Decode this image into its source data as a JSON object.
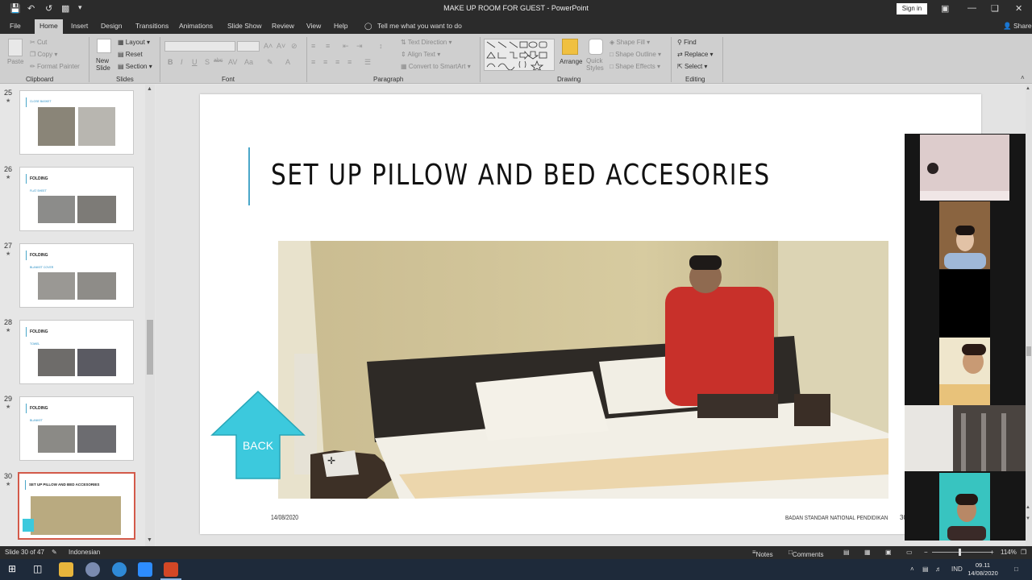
{
  "window": {
    "title": "MAKE UP ROOM FOR GUEST  -  PowerPoint",
    "sign_in": "Sign in"
  },
  "tabs": [
    "File",
    "Home",
    "Insert",
    "Design",
    "Transitions",
    "Animations",
    "Slide Show",
    "Review",
    "View",
    "Help"
  ],
  "tell_me": "Tell me what you want to do",
  "share": "Share",
  "ribbon": {
    "clipboard": {
      "label": "Clipboard",
      "paste": "Paste",
      "cut": "Cut",
      "copy": "Copy",
      "format_painter": "Format Painter"
    },
    "slides": {
      "label": "Slides",
      "new_slide": "New Slide",
      "layout": "Layout",
      "reset": "Reset",
      "section": "Section"
    },
    "font": {
      "label": "Font"
    },
    "paragraph": {
      "label": "Paragraph",
      "text_direction": "Text Direction",
      "align_text": "Align Text",
      "convert_smartart": "Convert to SmartArt"
    },
    "drawing": {
      "label": "Drawing",
      "arrange": "Arrange",
      "quick_styles": "Quick Styles",
      "shape_fill": "Shape Fill",
      "shape_outline": "Shape Outline",
      "shape_effects": "Shape Effects"
    },
    "editing": {
      "label": "Editing",
      "find": "Find",
      "replace": "Replace",
      "select": "Select"
    }
  },
  "thumbnails": [
    {
      "num": "25",
      "title": "",
      "sub": "CLOSE BASKET"
    },
    {
      "num": "26",
      "title": "FOLDING",
      "sub": "FLAT SHEET"
    },
    {
      "num": "27",
      "title": "FOLDING",
      "sub": "BLANKET COVER"
    },
    {
      "num": "28",
      "title": "FOLDING",
      "sub": "TOWEL"
    },
    {
      "num": "29",
      "title": "FOLDING",
      "sub": "BLANKET"
    },
    {
      "num": "30",
      "title": "SET UP PILLOW AND BED ACCESORIES",
      "sub": ""
    }
  ],
  "slide": {
    "title": "SET UP PILLOW AND BED ACCESORIES",
    "date": "14/08/2020",
    "org": "BADAN STANDAR NATIONAL PENDIDIKAN",
    "number": "30",
    "back_label": "BACK"
  },
  "status": {
    "slide_info": "Slide 30 of 47",
    "language": "Indonesian",
    "notes": "Notes",
    "comments": "Comments",
    "zoom": "114%"
  },
  "taskbar": {
    "lang": "IND",
    "time": "09.11",
    "date": "14/08/2020"
  },
  "colors": {
    "accent": "#4aa7c9",
    "back_arrow": "#3cc9dd",
    "selected_thumb": "#d35a4a",
    "chrome": "#2b2b2b"
  }
}
